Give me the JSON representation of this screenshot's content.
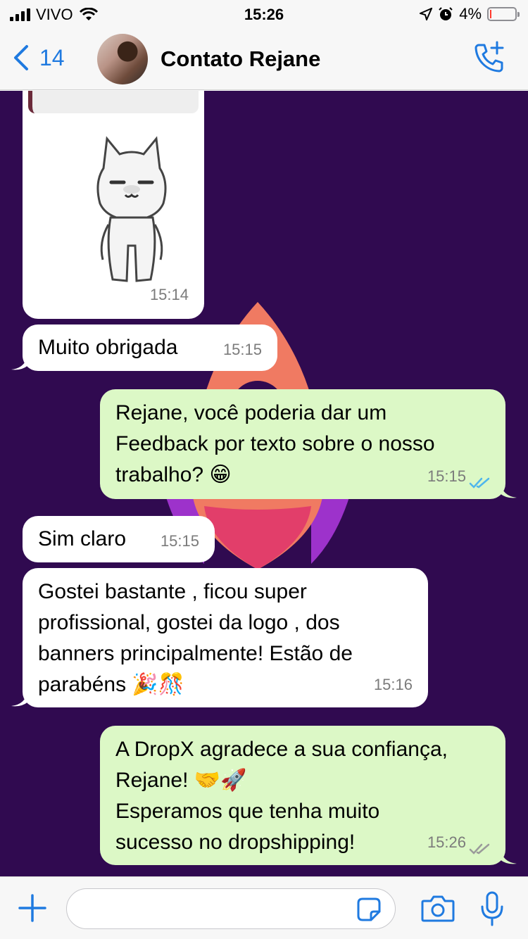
{
  "status_bar": {
    "carrier": "VIVO",
    "time": "15:26",
    "battery_percent": "4%",
    "battery_level": 0.04
  },
  "header": {
    "back_count": "14",
    "contact_name": "Contato Rejane"
  },
  "messages": [
    {
      "id": "sticker",
      "direction": "in",
      "type": "sticker",
      "time": "15:14"
    },
    {
      "id": "m1",
      "direction": "in",
      "lines": [
        "Muito obrigada"
      ],
      "time": "15:15"
    },
    {
      "id": "m2",
      "direction": "out",
      "lines": [
        "Rejane, você poderia dar um",
        "Feedback por texto sobre o nosso",
        "trabalho? 😁"
      ],
      "time": "15:15",
      "status": "read"
    },
    {
      "id": "m3",
      "direction": "in",
      "lines": [
        "Sim claro"
      ],
      "time": "15:15"
    },
    {
      "id": "m4",
      "direction": "in",
      "lines": [
        "Gostei bastante , ficou super",
        "profissional, gostei da logo , dos",
        "banners principalmente! Estão de",
        "parabéns 🎉🎊"
      ],
      "time": "15:16"
    },
    {
      "id": "m5",
      "direction": "out",
      "lines": [
        "A DropX agradece a sua confiança,",
        "Rejane! 🤝🚀",
        "Esperamos que tenha muito",
        "sucesso no dropshipping!"
      ],
      "time": "15:26",
      "status": "delivered"
    }
  ],
  "composer": {
    "placeholder": ""
  },
  "colors": {
    "chat_background": "#300a50",
    "incoming_bubble": "#ffffff",
    "outgoing_bubble": "#dcf8c6",
    "accent": "#1f7ae0",
    "read_ticks": "#4fb6ec",
    "delivered_ticks": "#9a9a9a"
  }
}
